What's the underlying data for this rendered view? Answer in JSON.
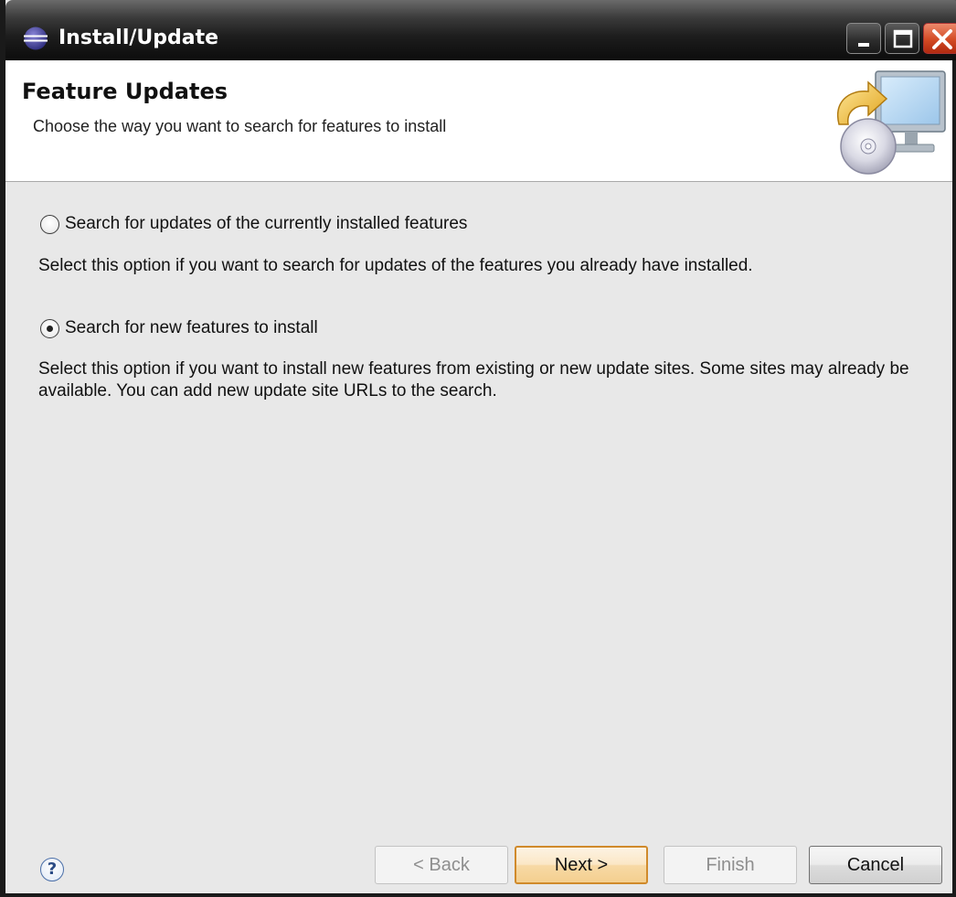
{
  "window": {
    "title": "Install/Update"
  },
  "header": {
    "title": "Feature Updates",
    "description": "Choose the way you want to search for features to install"
  },
  "options": [
    {
      "label": "Search for updates of the currently installed features",
      "description": "Select this option if you want to search for updates of the features you already have installed.",
      "selected": false
    },
    {
      "label": "Search for new features to install",
      "description": "Select this option if you want to install new features from existing or new update sites. Some sites may already be available. You can add new update site URLs to the search.",
      "selected": true
    }
  ],
  "footer": {
    "help_symbol": "?",
    "back_label": "< Back",
    "next_label": "Next >",
    "finish_label": "Finish",
    "cancel_label": "Cancel"
  },
  "icons": {
    "app": "eclipse-icon",
    "header": "install-update-computer-cd-icon",
    "help": "help-icon"
  },
  "colors": {
    "dialog_background": "#e8e8e8",
    "header_background": "#ffffff",
    "default_button_border": "#d08a2b"
  }
}
